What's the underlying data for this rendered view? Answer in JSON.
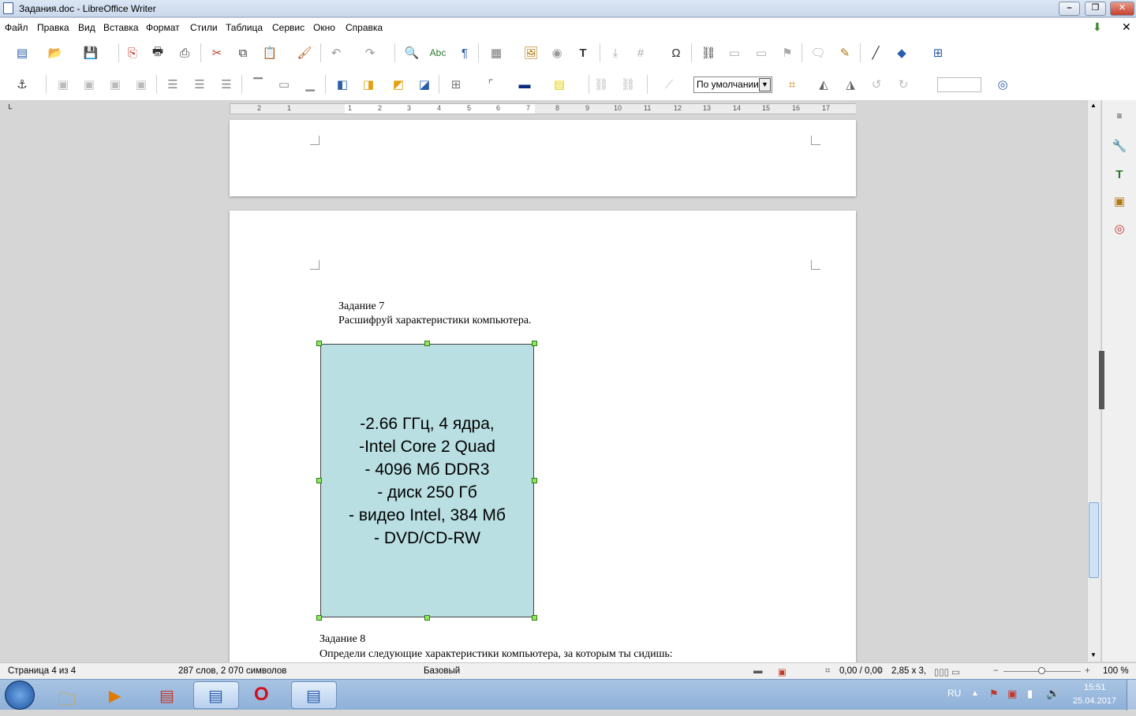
{
  "window": {
    "title": "Задания.doc - LibreOffice Writer"
  },
  "menu": [
    "Файл",
    "Правка",
    "Вид",
    "Вставка",
    "Формат",
    "Стили",
    "Таблица",
    "Сервис",
    "Окно",
    "Справка"
  ],
  "toolbar": {
    "style_value": "По умолчании"
  },
  "ruler": {
    "ticks": [
      "2",
      "1",
      "1",
      "2",
      "3",
      "4",
      "5",
      "6",
      "7",
      "8",
      "9",
      "10",
      "11",
      "12",
      "13",
      "14",
      "15",
      "16",
      "17"
    ]
  },
  "doc": {
    "task7_title": "Задание 7",
    "task7_text": "Расшифруй характеристики компьютера.",
    "shape_lines": [
      "-2.66 ГГц, 4 ядра,",
      "-Intel Core 2 Quad",
      "- 4096 Мб DDR3",
      "- диск 250 Гб",
      "- видео Intel, 384 Мб",
      "- DVD/CD-RW"
    ],
    "task8_title": "Задание 8",
    "task8_text": "Определи следующие характеристики компьютера, за которым ты сидишь:"
  },
  "status": {
    "page": "Страница 4 из 4",
    "words": "287 слов, 2 070 символов",
    "style": "Базовый",
    "position": "0,00 / 0,00",
    "size": "2,85 x 3,",
    "zoom": "100 %"
  },
  "taskbar": {
    "lang": "RU",
    "time": "15:51",
    "date": "25.04.2017"
  },
  "colors": {
    "shape_fill": "#b9dfe3",
    "titlebar": "#c9d8ec",
    "taskbar": "#8fb0d8"
  }
}
